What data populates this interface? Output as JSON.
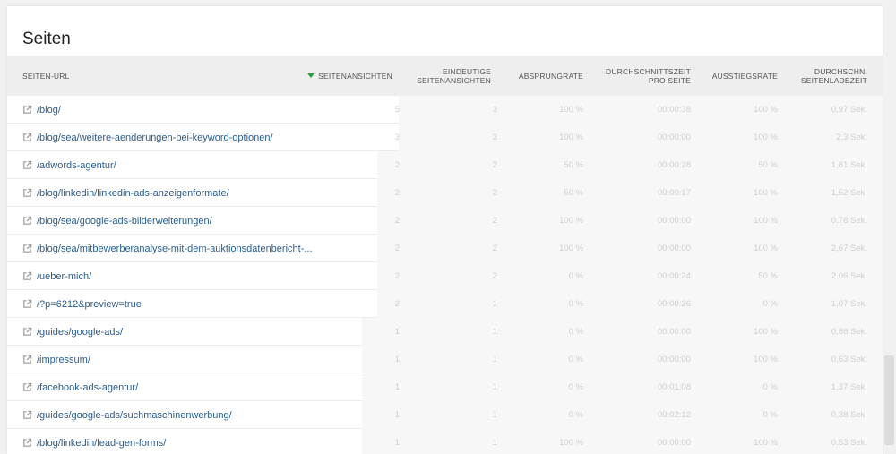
{
  "title": "Seiten",
  "columns": {
    "url": "Seiten-URL",
    "views": "Seitenansichten",
    "unique": "Eindeutige\nSeitenansichten",
    "bounce": "Absprungrate",
    "time": "Durchschnittszeit\npro Seite",
    "exit": "Ausstiegsrate",
    "load": "Durchschn.\nSeitenladezeit"
  },
  "icons": {
    "sort": "sort-descending-icon",
    "link": "external-link-icon"
  },
  "colors": {
    "accent": "#27a13a",
    "link": "#2b5e8f"
  },
  "rows": [
    {
      "url": "/blog/",
      "views": "5",
      "unique": "3",
      "bounce": "100 %",
      "time": "00:00:38",
      "exit": "100 %",
      "load": "0,97 Sek."
    },
    {
      "url": "/blog/sea/weitere-aenderungen-bei-keyword-optionen/",
      "views": "3",
      "unique": "3",
      "bounce": "100 %",
      "time": "00:00:00",
      "exit": "100 %",
      "load": "2,3 Sek."
    },
    {
      "url": "/adwords-agentur/",
      "views": "2",
      "unique": "2",
      "bounce": "50 %",
      "time": "00:00:28",
      "exit": "50 %",
      "load": "1,81 Sek."
    },
    {
      "url": "/blog/linkedin/linkedin-ads-anzeigenformate/",
      "views": "2",
      "unique": "2",
      "bounce": "50 %",
      "time": "00:00:17",
      "exit": "100 %",
      "load": "1,52 Sek."
    },
    {
      "url": "/blog/sea/google-ads-bilderweiterungen/",
      "views": "2",
      "unique": "2",
      "bounce": "100 %",
      "time": "00:00:00",
      "exit": "100 %",
      "load": "0,78 Sek."
    },
    {
      "url": "/blog/sea/mitbewerberanalyse-mit-dem-auktionsdatenbericht-...",
      "views": "2",
      "unique": "2",
      "bounce": "100 %",
      "time": "00:00:00",
      "exit": "100 %",
      "load": "2,67 Sek."
    },
    {
      "url": "/ueber-mich/",
      "views": "2",
      "unique": "2",
      "bounce": "0 %",
      "time": "00:00:24",
      "exit": "50 %",
      "load": "2,06 Sek."
    },
    {
      "url": "/?p=6212&preview=true",
      "views": "2",
      "unique": "1",
      "bounce": "0 %",
      "time": "00:00:26",
      "exit": "0 %",
      "load": "1,07 Sek."
    },
    {
      "url": "/guides/google-ads/",
      "views": "1",
      "unique": "1",
      "bounce": "0 %",
      "time": "00:00:00",
      "exit": "100 %",
      "load": "0,86 Sek."
    },
    {
      "url": "/impressum/",
      "views": "1",
      "unique": "1",
      "bounce": "0 %",
      "time": "00:00:00",
      "exit": "100 %",
      "load": "0,63 Sek."
    },
    {
      "url": "/facebook-ads-agentur/",
      "views": "1",
      "unique": "1",
      "bounce": "0 %",
      "time": "00:01:08",
      "exit": "0 %",
      "load": "1,37 Sek."
    },
    {
      "url": "/guides/google-ads/suchmaschinenwerbung/",
      "views": "1",
      "unique": "1",
      "bounce": "0 %",
      "time": "00:02:12",
      "exit": "0 %",
      "load": "0,38 Sek."
    },
    {
      "url": "/blog/linkedin/lead-gen-forms/",
      "views": "1",
      "unique": "1",
      "bounce": "100 %",
      "time": "00:00:00",
      "exit": "100 %",
      "load": "0,53 Sek."
    }
  ]
}
